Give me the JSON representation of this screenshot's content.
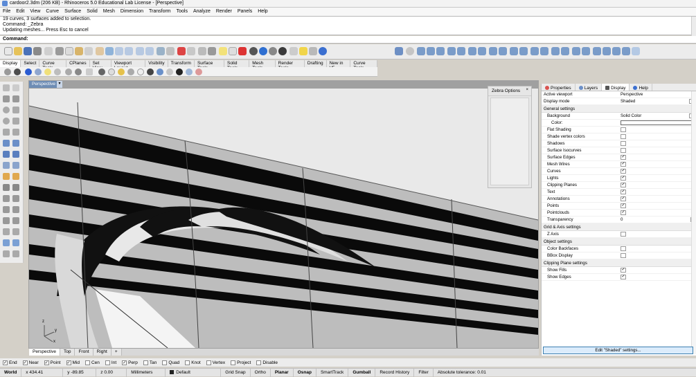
{
  "window": {
    "title": "cardoor2.3dm (206 KB) - Rhinoceros 5.0 Educational Lab License - [Perspective]"
  },
  "menu": [
    "File",
    "Edit",
    "View",
    "Curve",
    "Surface",
    "Solid",
    "Mesh",
    "Dimension",
    "Transform",
    "Tools",
    "Analyze",
    "Render",
    "Panels",
    "Help"
  ],
  "command": {
    "history": [
      "19 curves, 3 surfaces added to selection.",
      "Command: _Zebra",
      "Updating meshes... Press Esc to cancel"
    ],
    "prompt": "Command:"
  },
  "toolbar_tabs": [
    "Display",
    "Select",
    "Curve Tools",
    "CPlanes",
    "Set View",
    "Viewport Layout",
    "Visibility",
    "Transform",
    "Surface Tools",
    "Solid Tools",
    "Mesh Tools",
    "Render Tools",
    "Drafting",
    "New in V5",
    "Curve Tools"
  ],
  "viewport": {
    "label": "Perspective",
    "axis_labels": [
      "z",
      "y",
      "x"
    ]
  },
  "zebra": {
    "title": "Zebra Options",
    "close": "×"
  },
  "viewport_tabs": [
    "Perspective",
    "Top",
    "Front",
    "Right",
    "+"
  ],
  "panel_tabs": [
    "Properties",
    "Layers",
    "Display",
    "Help"
  ],
  "panel": {
    "active_viewport": {
      "label": "Active viewport",
      "value": "Perspective"
    },
    "display_mode": {
      "label": "Display mode",
      "value": "Shaded"
    },
    "general": "General settings",
    "background": {
      "label": "Background",
      "value": "Solid Color"
    },
    "color_label": "Color:",
    "items": [
      {
        "label": "Flat Shading",
        "checked": ""
      },
      {
        "label": "Shade vertex colors",
        "checked": ""
      },
      {
        "label": "Shadows",
        "checked": ""
      },
      {
        "label": "Surface Isocurves",
        "checked": ""
      },
      {
        "label": "Surface Edges",
        "checked": "✓"
      },
      {
        "label": "Mesh Wires",
        "checked": "✓"
      },
      {
        "label": "Curves",
        "checked": "✓"
      },
      {
        "label": "Lights",
        "checked": "✓"
      },
      {
        "label": "Clipping Planes",
        "checked": "✓"
      },
      {
        "label": "Text",
        "checked": "✓"
      },
      {
        "label": "Annotations",
        "checked": "✓"
      },
      {
        "label": "Points",
        "checked": "✓"
      },
      {
        "label": "Pointclouds",
        "checked": "✓"
      }
    ],
    "transparency": {
      "label": "Transparency",
      "value": "0"
    },
    "grid_axis": "Grid & Axis settings",
    "z_axis": {
      "label": "Z Axis",
      "checked": ""
    },
    "object": "Object settings",
    "color_backfaces": {
      "label": "Color Backfaces",
      "checked": ""
    },
    "bbox": {
      "label": "BBox Display",
      "checked": ""
    },
    "clipping": "Clipping Plane settings",
    "show_fills": {
      "label": "Show Fills",
      "checked": "✓"
    },
    "show_edges": {
      "label": "Show Edges",
      "checked": "✓"
    },
    "edit_button": "Edit \"Shaded\" settings..."
  },
  "osnap": [
    {
      "label": "End",
      "checked": "✓"
    },
    {
      "label": "Near",
      "checked": "✓"
    },
    {
      "label": "Point",
      "checked": "✓"
    },
    {
      "label": "Mid",
      "checked": "✓"
    },
    {
      "label": "Cen",
      "checked": ""
    },
    {
      "label": "Int",
      "checked": ""
    },
    {
      "label": "Perp",
      "checked": "✓"
    },
    {
      "label": "Tan",
      "checked": ""
    },
    {
      "label": "Quad",
      "checked": ""
    },
    {
      "label": "Knot",
      "checked": ""
    },
    {
      "label": "Vertex",
      "checked": ""
    },
    {
      "label": "Project",
      "checked": ""
    },
    {
      "label": "Disable",
      "checked": ""
    }
  ],
  "status": {
    "cplane": "World",
    "x": "x 434.41",
    "y": "y -89.85",
    "z": "z 0.00",
    "units": "Millimeters",
    "layer": "Default",
    "grid_snap": "Grid Snap",
    "ortho": "Ortho",
    "planar": "Planar",
    "osnap": "Osnap",
    "smarttrack": "SmartTrack",
    "gumball": "Gumball",
    "record": "Record History",
    "filter": "Filter",
    "tolerance": "Absolute tolerance: 0.01"
  }
}
